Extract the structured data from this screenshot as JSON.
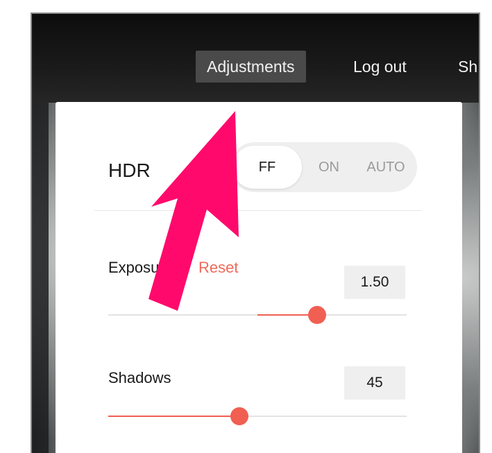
{
  "nav": {
    "items": [
      "Adjustments",
      "Log out",
      "Sh"
    ],
    "active": "Adjustments"
  },
  "hdr": {
    "label": "HDR",
    "options": [
      "FF",
      "ON",
      "AUTO"
    ],
    "selected": "FF"
  },
  "exposure": {
    "label": "Exposu",
    "reset_label": "Reset",
    "value": "1.50",
    "level": 0.7
  },
  "shadows": {
    "label": "Shadows",
    "value": "45",
    "level": 0.44
  },
  "colors": {
    "accent": "#f05f52",
    "arrow": "#ff0a6c",
    "toggle_bg": "#efefef"
  },
  "icons": {
    "arrow": "pointer-arrow-icon"
  }
}
